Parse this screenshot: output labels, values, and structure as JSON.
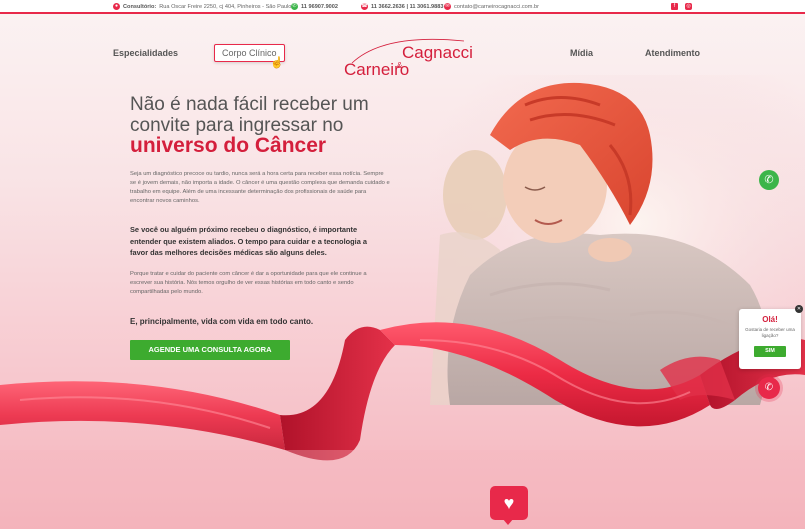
{
  "topbar": {
    "address_label": "Consultório:",
    "address": "Rua Oscar Freire 2250, cj 404, Pinheiros - São Paulo",
    "whatsapp": "11 96907.9002",
    "phones": "11 3662.2636 | 11 3061.9883",
    "email": "contato@carneirocagnacci.com.br",
    "social": [
      "facebook-icon",
      "instagram-icon"
    ]
  },
  "nav": {
    "items": [
      "Especialidades",
      "Corpo Clínico",
      "Mídia",
      "Atendimento"
    ],
    "active": "Corpo Clínico"
  },
  "logo": {
    "part1": "Carneiro",
    "amp": "&",
    "part2": "Cagnacci"
  },
  "hero": {
    "headline_light": "Não é nada fácil receber um convite para ingressar no",
    "headline_strong": "universo do Câncer",
    "paragraph1": "Seja um diagnóstico precoce ou tardio, nunca será a hora certa para receber essa notícia. Sempre se é jovem demais, não importa a idade. O câncer é uma questão complexa que demanda cuidado e trabalho em equipe. Além de uma incessante determinação dos profissionais de saúde para encontrar novos caminhos.",
    "paragraph2": "Se você ou alguém próximo recebeu o diagnóstico, é importante entender que existem aliados. O tempo para cuidar e a tecnologia a favor das melhores decisões médicas são alguns deles.",
    "paragraph3": "Porque tratar e cuidar do paciente com câncer é dar a oportunidade para que ele continue a escrever sua história. Nós temos orgulho de ver essas histórias em todo canto e sendo compartilhadas pelo mundo.",
    "paragraph4": "E, principalmente, vida com vida em todo canto.",
    "cta": "AGENDE UMA CONSULTA AGORA"
  },
  "popup": {
    "title": "Olá!",
    "message": "Gostaria de receber uma ligação?",
    "button": "SIM"
  },
  "colors": {
    "brand": "#e8294a",
    "brand_dark": "#d41f3c",
    "cta": "#3dab2f",
    "whatsapp": "#3cb54a"
  }
}
